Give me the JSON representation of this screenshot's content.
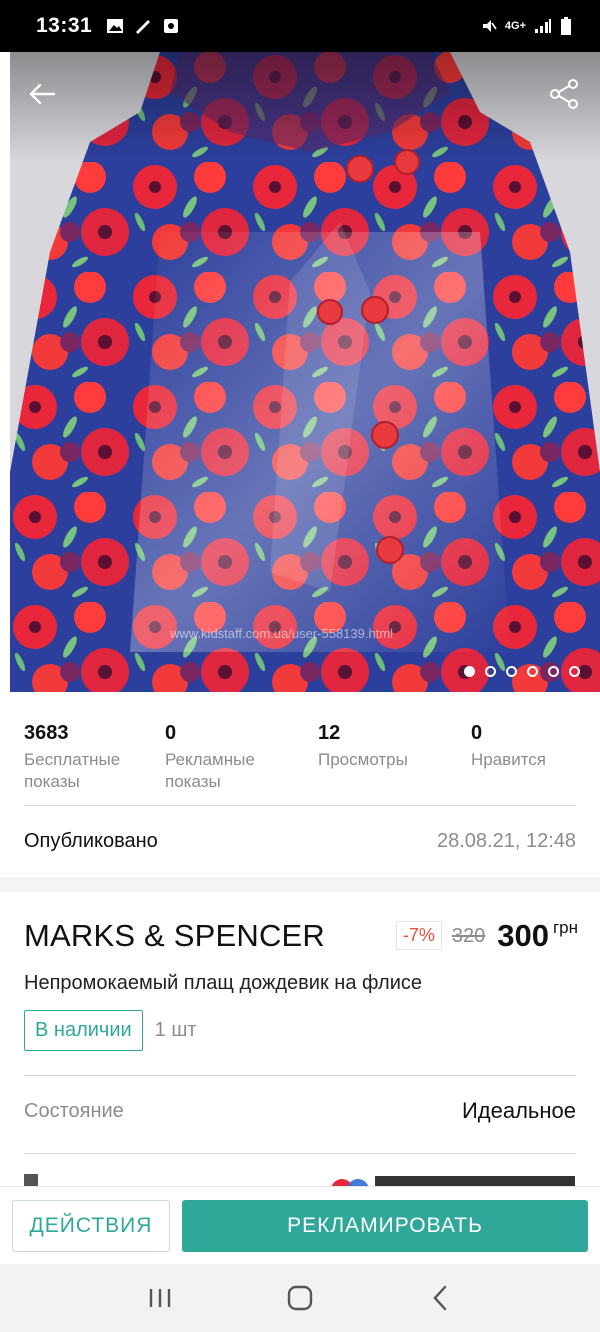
{
  "status_bar": {
    "time": "13:31",
    "network": "4G+"
  },
  "photo": {
    "watermark": "www.kidstaff.com.ua/user-558139.html",
    "slide_count": 6,
    "active_slide": 1
  },
  "stats": [
    {
      "value": "3683",
      "label": "Бесплатные показы"
    },
    {
      "value": "0",
      "label": "Рекламные показы"
    },
    {
      "value": "12",
      "label": "Просмотры"
    },
    {
      "value": "0",
      "label": "Нравится"
    }
  ],
  "published": {
    "label": "Опубликовано",
    "date": "28.08.21, 12:48"
  },
  "product": {
    "brand": "MARKS & SPENCER",
    "discount": "-7%",
    "old_price": "320",
    "price": "300",
    "currency": "грн",
    "title": "Непромокаемый плащ дождевик на флисе",
    "stock_badge": "В наличии",
    "quantity": "1 шт"
  },
  "details": {
    "condition_label": "Состояние",
    "condition_value": "Идеальное"
  },
  "actions": {
    "actions_label": "ДЕЙСТВИЯ",
    "promote_label": "РЕКЛАМИРОВАТЬ"
  },
  "colors": {
    "accent": "#2fa89a",
    "discount": "#e1523a",
    "muted_text": "#8c8c8c"
  }
}
